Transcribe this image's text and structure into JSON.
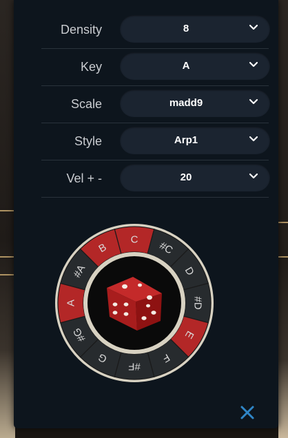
{
  "settings": [
    {
      "label": "Density",
      "value": "8"
    },
    {
      "label": "Key",
      "value": "A"
    },
    {
      "label": "Scale",
      "value": "madd9"
    },
    {
      "label": "Style",
      "value": "Arp1"
    },
    {
      "label": "Vel + -",
      "value": "20"
    }
  ],
  "wheel": {
    "notes": [
      {
        "name": "C",
        "active": true
      },
      {
        "name": "#C",
        "active": false
      },
      {
        "name": "D",
        "active": false
      },
      {
        "name": "#D",
        "active": false
      },
      {
        "name": "E",
        "active": true
      },
      {
        "name": "F",
        "active": false
      },
      {
        "name": "#F",
        "active": false
      },
      {
        "name": "G",
        "active": false
      },
      {
        "name": "#G",
        "active": false
      },
      {
        "name": "A",
        "active": true
      },
      {
        "name": "#A",
        "active": false
      },
      {
        "name": "B",
        "active": true
      }
    ],
    "center_icon": "dice-icon"
  },
  "close_icon": "close-icon",
  "colors": {
    "active": "#b32727",
    "inactive": "#272b2e",
    "accent": "#2f86c7",
    "ring": "#d8d2c2"
  }
}
